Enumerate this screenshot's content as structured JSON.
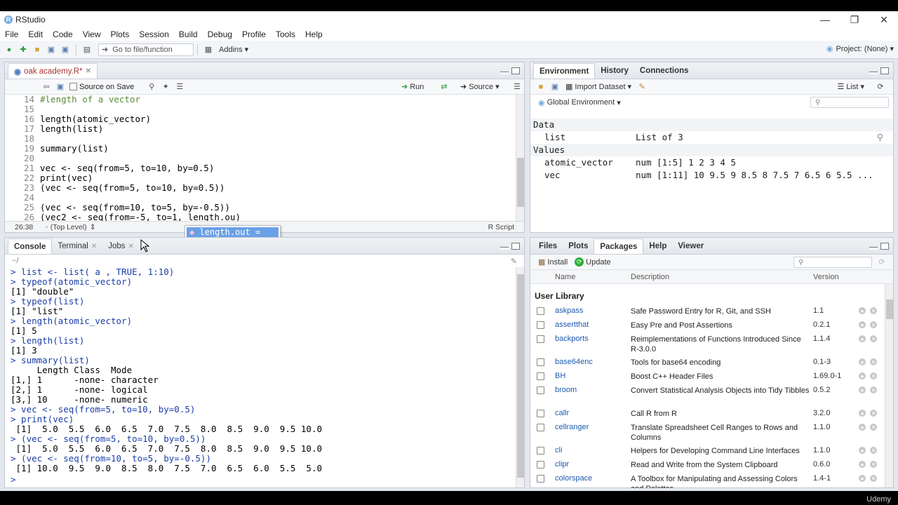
{
  "window": {
    "title": "RStudio"
  },
  "menu": [
    "File",
    "Edit",
    "Code",
    "View",
    "Plots",
    "Session",
    "Build",
    "Debug",
    "Profile",
    "Tools",
    "Help"
  ],
  "toolbar": {
    "goto_placeholder": "Go to file/function",
    "addins_label": "Addins",
    "project_label": "Project: (None)"
  },
  "editor": {
    "tab_label": "oak academy.R*",
    "source_on_save_label": "Source on Save",
    "run_label": "Run",
    "source_label": "Source",
    "lines": [
      {
        "n": "14",
        "code": "#length of a vector",
        "comment": true
      },
      {
        "n": "15",
        "code": ""
      },
      {
        "n": "16",
        "code": "length(atomic_vector)"
      },
      {
        "n": "17",
        "code": "length(list)"
      },
      {
        "n": "18",
        "code": ""
      },
      {
        "n": "19",
        "code": "summary(list)"
      },
      {
        "n": "20",
        "code": ""
      },
      {
        "n": "21",
        "code": "vec <- seq(from=5, to=10, by=0.5)"
      },
      {
        "n": "22",
        "code": "print(vec)"
      },
      {
        "n": "23",
        "code": "(vec <- seq(from=5, to=10, by=0.5))"
      },
      {
        "n": "24",
        "code": ""
      },
      {
        "n": "25",
        "code": "(vec <- seq(from=10, to=5, by=-0.5))"
      },
      {
        "n": "26",
        "code": "(vec2 <- seq(from=-5, to=1, length.ou)"
      }
    ],
    "status_position": "26:38",
    "status_scope": "(Top Level)",
    "status_filetype": "R Script",
    "autocomplete_item": "length.out ="
  },
  "console": {
    "tabs": [
      "Console",
      "Terminal",
      "Jobs"
    ],
    "path": "~/",
    "lines": [
      {
        "kind": "prompt",
        "text": "> list <- list( a , TRUE, 1:10)"
      },
      {
        "kind": "prompt",
        "text": "> typeof(atomic_vector)"
      },
      {
        "kind": "output",
        "text": "[1] \"double\""
      },
      {
        "kind": "prompt",
        "text": "> typeof(list)"
      },
      {
        "kind": "output",
        "text": "[1] \"list\""
      },
      {
        "kind": "prompt",
        "text": "> length(atomic_vector)"
      },
      {
        "kind": "output",
        "text": "[1] 5"
      },
      {
        "kind": "prompt",
        "text": "> length(list)"
      },
      {
        "kind": "output",
        "text": "[1] 3"
      },
      {
        "kind": "prompt",
        "text": "> summary(list)"
      },
      {
        "kind": "output",
        "text": "     Length Class  Mode     "
      },
      {
        "kind": "output",
        "text": "[1,] 1      -none- character"
      },
      {
        "kind": "output",
        "text": "[2,] 1      -none- logical  "
      },
      {
        "kind": "output",
        "text": "[3,] 10     -none- numeric  "
      },
      {
        "kind": "prompt",
        "text": "> vec <- seq(from=5, to=10, by=0.5)"
      },
      {
        "kind": "prompt",
        "text": "> print(vec)"
      },
      {
        "kind": "output",
        "text": " [1]  5.0  5.5  6.0  6.5  7.0  7.5  8.0  8.5  9.0  9.5 10.0"
      },
      {
        "kind": "prompt",
        "text": "> (vec <- seq(from=5, to=10, by=0.5))"
      },
      {
        "kind": "output",
        "text": " [1]  5.0  5.5  6.0  6.5  7.0  7.5  8.0  8.5  9.0  9.5 10.0"
      },
      {
        "kind": "prompt",
        "text": "> (vec <- seq(from=10, to=5, by=-0.5))"
      },
      {
        "kind": "output",
        "text": " [1] 10.0  9.5  9.0  8.5  8.0  7.5  7.0  6.5  6.0  5.5  5.0"
      },
      {
        "kind": "prompt",
        "text": "> "
      }
    ]
  },
  "environment": {
    "tabs": [
      "Environment",
      "History",
      "Connections"
    ],
    "import_label": "Import Dataset",
    "list_label": "List",
    "scope_label": "Global Environment",
    "sections": [
      {
        "label": "Data",
        "rows": [
          {
            "name": "list",
            "value": "List of 3"
          }
        ]
      },
      {
        "label": "Values",
        "rows": [
          {
            "name": "atomic_vector",
            "value": "num [1:5] 1 2 3 4 5"
          },
          {
            "name": "vec",
            "value": "num [1:11] 10 9.5 9 8.5 8 7.5 7 6.5 6 5.5 ..."
          }
        ]
      }
    ]
  },
  "files": {
    "tabs": [
      "Files",
      "Plots",
      "Packages",
      "Help",
      "Viewer"
    ],
    "install_label": "Install",
    "update_label": "Update",
    "columns": [
      "Name",
      "Description",
      "Version"
    ],
    "section": "User Library",
    "packages": [
      {
        "name": "askpass",
        "desc": "Safe Password Entry for R, Git, and SSH",
        "ver": "1.1"
      },
      {
        "name": "assertthat",
        "desc": "Easy Pre and Post Assertions",
        "ver": "0.2.1"
      },
      {
        "name": "backports",
        "desc": "Reimplementations of Functions Introduced Since R-3.0.0",
        "ver": "1.1.4"
      },
      {
        "name": "base64enc",
        "desc": "Tools for base64 encoding",
        "ver": "0.1-3"
      },
      {
        "name": "BH",
        "desc": "Boost C++ Header Files",
        "ver": "1.69.0-1"
      },
      {
        "name": "broom",
        "desc": "Convert Statistical Analysis Objects into Tidy Tibbles",
        "ver": "0.5.2"
      },
      {
        "name": "callr",
        "desc": "Call R from R",
        "ver": "3.2.0"
      },
      {
        "name": "cellranger",
        "desc": "Translate Spreadsheet Cell Ranges to Rows and Columns",
        "ver": "1.1.0"
      },
      {
        "name": "cli",
        "desc": "Helpers for Developing Command Line Interfaces",
        "ver": "1.1.0"
      },
      {
        "name": "clipr",
        "desc": "Read and Write from the System Clipboard",
        "ver": "0.6.0"
      },
      {
        "name": "colorspace",
        "desc": "A Toolbox for Manipulating and Assessing Colors and Palettes",
        "ver": "1.4-1"
      }
    ]
  },
  "watermark": "Udemy"
}
